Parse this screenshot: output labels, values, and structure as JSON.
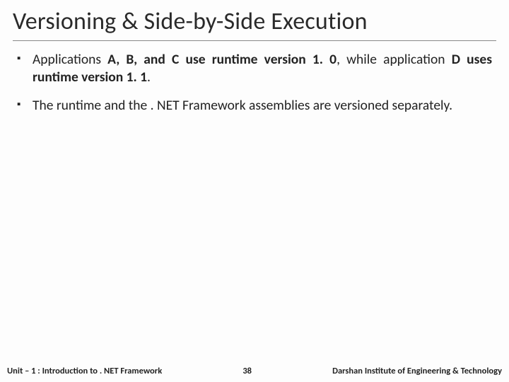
{
  "title": "Versioning & Side-by-Side Execution",
  "bullets": {
    "b1": {
      "pre": "Applications ",
      "strong1": "A, B, and C use runtime version 1. 0",
      "mid": ", while application ",
      "strong2": "D uses runtime version 1. 1",
      "post": "."
    },
    "b2": "The runtime and the . NET Framework assemblies are versioned separately."
  },
  "footer": {
    "left": "Unit – 1 : Introduction to . NET Framework",
    "page": "38",
    "right": "Darshan Institute of Engineering & Technology"
  }
}
